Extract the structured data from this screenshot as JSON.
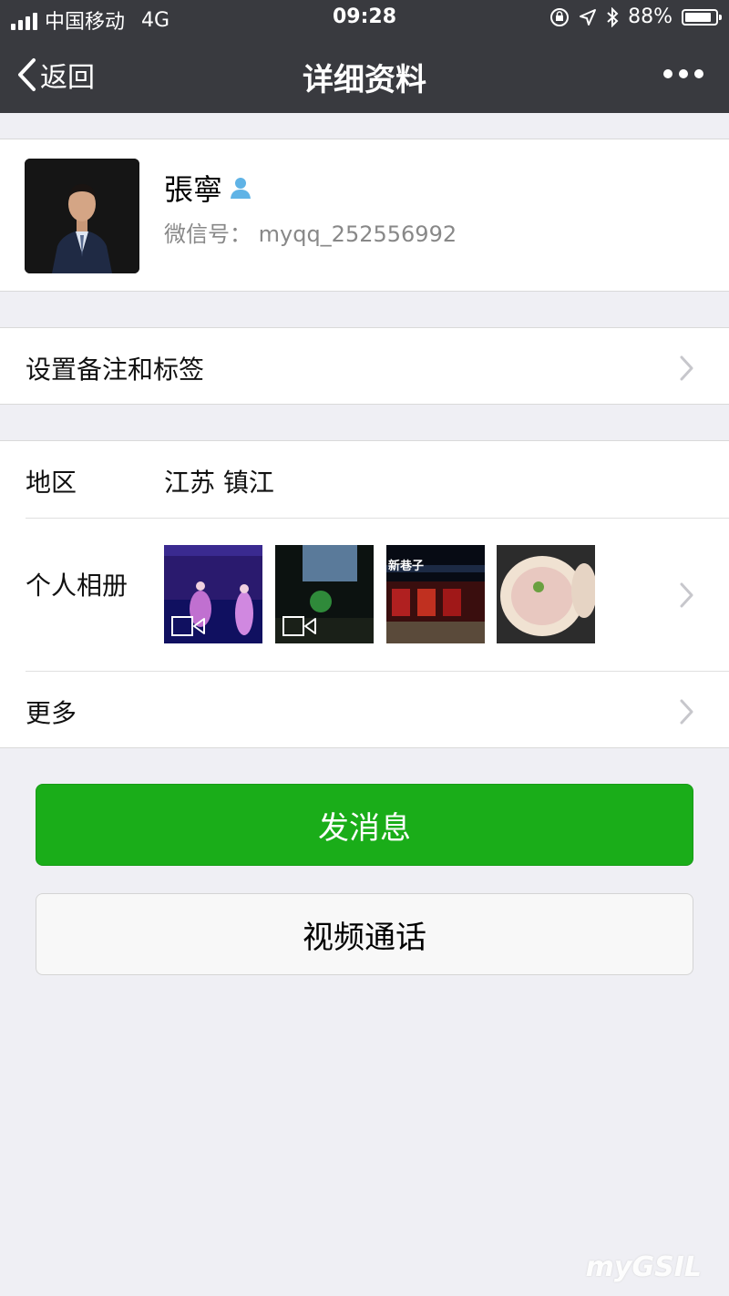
{
  "status_bar": {
    "carrier": "中国移动",
    "network": "4G",
    "time": "09:28",
    "battery": "88%",
    "battery_level": 0.88
  },
  "nav": {
    "back_label": "返回",
    "title": "详细资料"
  },
  "profile": {
    "name": "張寧",
    "wechat_id": "微信号：  myqq_252556992"
  },
  "remark_row": {
    "label": "设置备注和标签"
  },
  "region_row": {
    "label": "地区",
    "value": "江苏 镇江"
  },
  "album_row": {
    "label": "个人相册",
    "photos": [
      {
        "type": "video",
        "icon": "video-icon"
      },
      {
        "type": "video",
        "icon": "video-icon"
      },
      {
        "type": "photo",
        "caption": "新巷子"
      },
      {
        "type": "photo"
      }
    ]
  },
  "more_row": {
    "label": "更多"
  },
  "actions": {
    "send_message": "发消息",
    "video_call": "视频通话"
  },
  "colors": {
    "nav_bg": "#393a3f",
    "primary_green": "#1aad19",
    "page_bg": "#efeff4"
  },
  "watermark": "myGSIL"
}
